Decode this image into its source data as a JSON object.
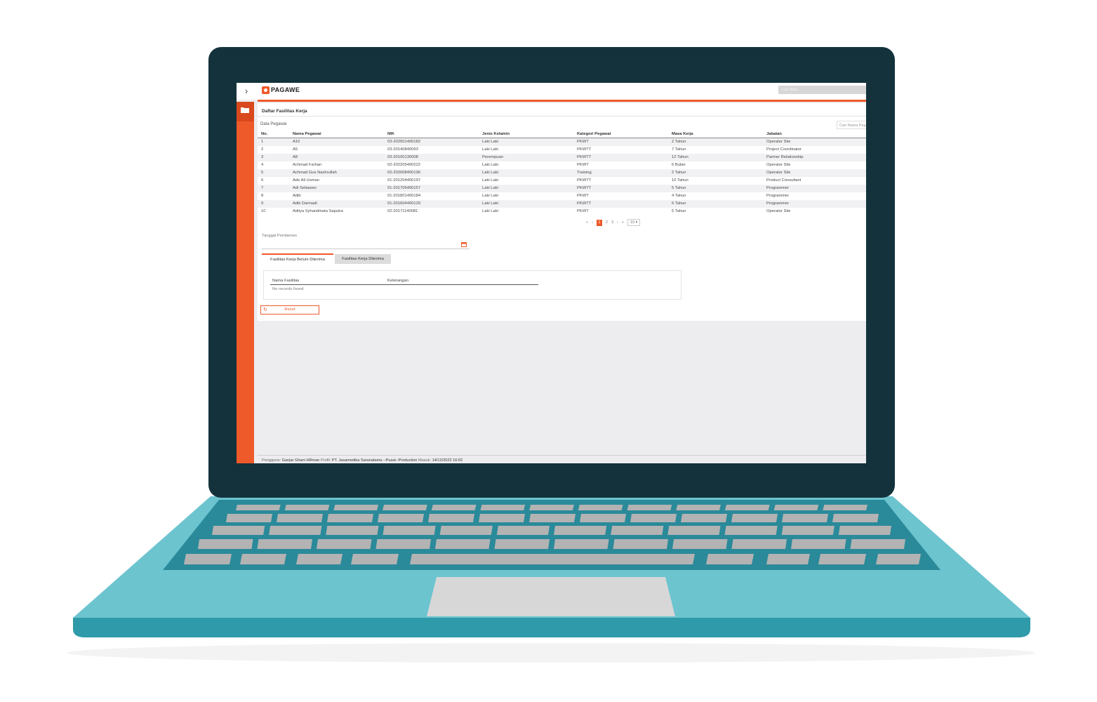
{
  "app": {
    "logo_text": "PAGAWE",
    "top_search_placeholder": "Cari Menu"
  },
  "page": {
    "title": "Daftar Fasilitas Kerja",
    "section_label": "Data Pegawai",
    "search_placeholder": "Cari Nama Pegawai"
  },
  "table": {
    "columns": [
      "No.",
      "Nama Pegawai",
      "NIK",
      "Jenis Kelamin",
      "Kategori Pegawai",
      "Masa Kerja",
      "Jabatan"
    ],
    "rows": [
      [
        "1",
        "A10",
        "03-202001400182",
        "Laki Laki",
        "PKWT",
        "2 Tahun",
        "Operator Site"
      ],
      [
        "2",
        "A5",
        "03-20140840093",
        "Laki Laki",
        "PKWTT",
        "7 Tahun",
        "Project Coordinator"
      ],
      [
        "3",
        "A8",
        "03-20100130008",
        "Perempuan",
        "PKWTT",
        "12 Tahun",
        "Partner Relationship"
      ],
      [
        "4",
        "Achmad Farhan",
        "02-202205400222",
        "Laki Laki",
        "PKWT",
        "6 Bulan",
        "Operator Site"
      ],
      [
        "5",
        "Achmad Gus Nashrullah",
        "02-202008400196",
        "Laki Laki",
        "Training",
        "2 Tahun",
        "Operator Site"
      ],
      [
        "6",
        "Ade Ali Usman",
        "01-201204400197",
        "Laki Laki",
        "PKWTT",
        "10 Tahun",
        "Product Consultant"
      ],
      [
        "7",
        "Adi Setiawan",
        "01-201705400157",
        "Laki Laki",
        "PKWTT",
        "5 Tahun",
        "Programmer"
      ],
      [
        "8",
        "Adib",
        "01-201801400184",
        "Laki Laki",
        "PKWT",
        "4 Tahun",
        "Programmer"
      ],
      [
        "9",
        "Adik Darmadi",
        "01-201604400129",
        "Laki Laki",
        "PKWTT",
        "6 Tahun",
        "Programmer"
      ],
      [
        "10",
        "Aditya Syhandinata Saputra",
        "02-20171140081",
        "Laki Laki",
        "PKWT",
        "5 Tahun",
        "Operator Site"
      ]
    ]
  },
  "pagination": {
    "first": "«",
    "prev": "‹",
    "pages": [
      "1",
      "2",
      "3"
    ],
    "active_page": "1",
    "next": "›",
    "last": "»",
    "page_size": "10"
  },
  "form": {
    "date_label": "Tanggal Pemberian",
    "tabs": [
      "Fasilitas Kerja Belum Diterima",
      "Fasilitas Kerja Diterima"
    ],
    "facility_columns": [
      "Nama Fasilitas",
      "Keterangan"
    ],
    "empty_message": "No records found",
    "reset_label": "Reset"
  },
  "footer": {
    "user_label": "Pengguna:",
    "user_name": "Ganjar Ghani HRman",
    "profile_label": "Profil:",
    "profile_value": "PT. Jasamedika Saranatama --Pusat--Production",
    "login_label": "Masuk:",
    "login_time": "14/12/2022 16:02"
  },
  "colors": {
    "accent": "#ef5a2a",
    "bezel": "#14323c",
    "laptop_base": "#6cc4cf",
    "keys": "#b3b3b3"
  },
  "icons": [
    "chevron-right-icon",
    "folder-icon",
    "calendar-icon",
    "refresh-icon"
  ]
}
